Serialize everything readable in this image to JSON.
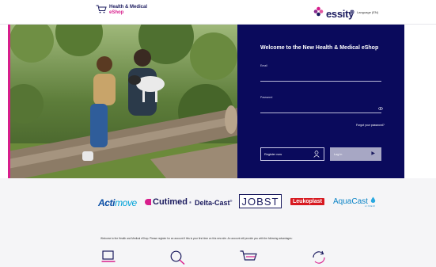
{
  "header": {
    "shop_logo_line1": "Health & Medical",
    "shop_logo_line2": "eShop",
    "brand_logo": "essity",
    "language_label": "Language (EN)",
    "icons": [
      "cart-icon",
      "essity-flower-icon",
      "globe-icon"
    ]
  },
  "hero": {
    "image_description": "",
    "accent_color": "#d81e8c"
  },
  "login": {
    "title": "Welcome to the New Health & Medical eShop",
    "email_label": "Email",
    "email_value": "",
    "password_label": "Password",
    "password_value": "",
    "forgot_label": "Forgot your password?",
    "register_label": "Register now",
    "login_label": "Log in",
    "panel_color": "#0a0a5c",
    "login_button_color": "#a7a7c4"
  },
  "brands": {
    "actimove_a": "Acti",
    "actimove_b": "move",
    "cutimed": "Cutimed",
    "cutimed_reg": "®",
    "deltacast": "Delta-Cast",
    "deltacast_reg": "®",
    "jobst": "JOBST",
    "leukoplast": "Leukoplast",
    "aquacast": "AquaCast",
    "aquacast_sub": "LINER"
  },
  "intro_text": "Welcome to the Health and Medical eShop. Please register for an account if this is your first time on this new site. An account will provide you with the following advantages:",
  "feature_icons": [
    "laptop-icon",
    "search-icon",
    "cart-icon",
    "refresh-icon"
  ]
}
